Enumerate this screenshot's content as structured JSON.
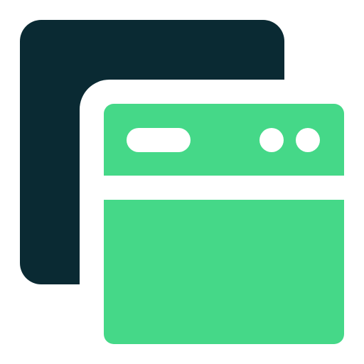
{
  "icon": {
    "name": "multiple-windows-icon",
    "colors": {
      "back_window": "#0A2A33",
      "front_window": "#45D888",
      "separator": "#FFFFFF",
      "background": "#FFFFFF"
    }
  }
}
